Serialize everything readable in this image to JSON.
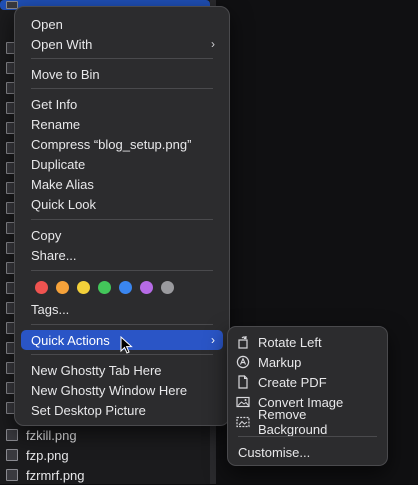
{
  "finder": {
    "files": [
      "fzkill.png",
      "fzp.png",
      "fzrmrf.png"
    ]
  },
  "menu": {
    "open": "Open",
    "open_with": "Open With",
    "move_to_bin": "Move to Bin",
    "get_info": "Get Info",
    "rename": "Rename",
    "compress": "Compress “blog_setup.png”",
    "duplicate": "Duplicate",
    "make_alias": "Make Alias",
    "quick_look": "Quick Look",
    "copy": "Copy",
    "share": "Share...",
    "tags": "Tags...",
    "quick_actions": "Quick Actions",
    "new_ghostty_tab": "New Ghostty Tab Here",
    "new_ghostty_window": "New Ghostty Window Here",
    "set_desktop_picture": "Set Desktop Picture",
    "tag_colors": [
      "#ef5350",
      "#f6a23a",
      "#f3d03a",
      "#43c65a",
      "#3a86f0",
      "#b66be6",
      "#9a9a9e"
    ]
  },
  "submenu": {
    "rotate_left": "Rotate Left",
    "markup": "Markup",
    "create_pdf": "Create PDF",
    "convert_image": "Convert Image",
    "remove_background": "Remove Background",
    "customise": "Customise..."
  },
  "colors": {
    "accent": "#2a55c6",
    "menu_bg": "#2c2c2e"
  }
}
